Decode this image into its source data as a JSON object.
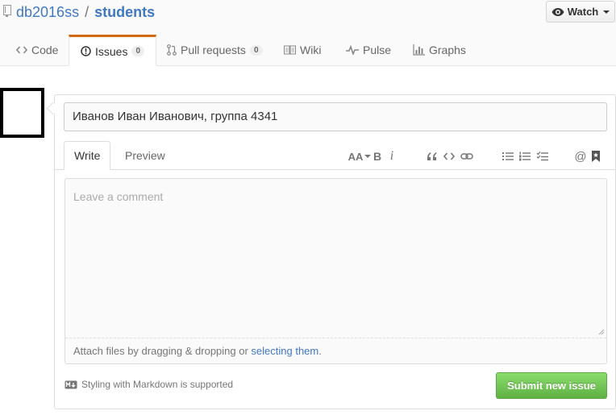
{
  "header": {
    "owner": "db2016ss",
    "separator": "/",
    "repo": "students",
    "watch_label": "Watch"
  },
  "tabs": [
    {
      "label": "Code",
      "icon": "code-icon"
    },
    {
      "label": "Issues",
      "count": "0",
      "icon": "issue-opened-icon"
    },
    {
      "label": "Pull requests",
      "count": "0",
      "icon": "git-pull-request-icon"
    },
    {
      "label": "Wiki",
      "icon": "book-icon"
    },
    {
      "label": "Pulse",
      "icon": "pulse-icon"
    },
    {
      "label": "Graphs",
      "icon": "graph-icon"
    }
  ],
  "issue_form": {
    "title_value": "Иванов Иван Иванович, группа 4341",
    "write_tab": "Write",
    "preview_tab": "Preview",
    "comment_placeholder": "Leave a comment",
    "attach_text": "Attach files by dragging & dropping or ",
    "attach_link": "selecting them",
    "attach_end": ".",
    "markdown_note": "Styling with Markdown is supported",
    "submit_label": "Submit new issue"
  },
  "toolbar": {
    "header_label": "AA",
    "bold_label": "B",
    "italic_label": "i",
    "mention_label": "@"
  },
  "colors": {
    "link": "#4078c0",
    "selected_tab_accent": "#d26911",
    "submit_green": "#6cc644"
  }
}
